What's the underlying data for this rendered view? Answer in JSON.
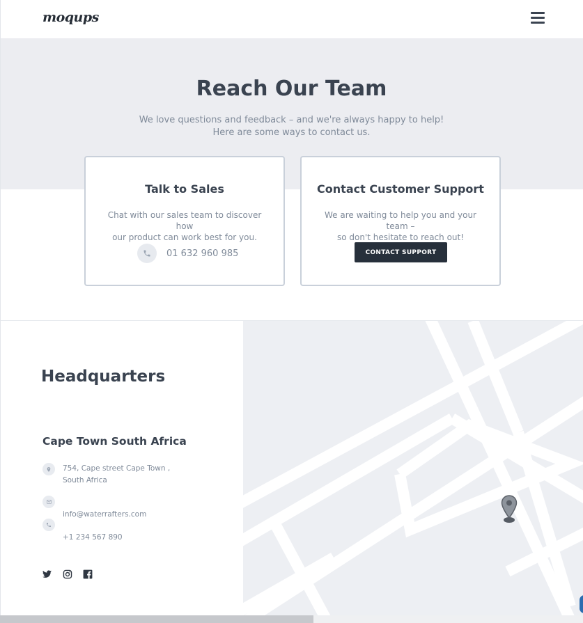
{
  "header": {
    "logo": "moqups",
    "menu_icon": "hamburger-menu-icon"
  },
  "hero": {
    "title": "Reach Our Team",
    "subtitle_line1": "We love questions and feedback – and we're always happy to help!",
    "subtitle_line2": "Here are some ways to contact us."
  },
  "sales_card": {
    "title": "Talk to Sales",
    "desc_line1": "Chat with our sales team to discover how",
    "desc_line2": "our product can work best for you.",
    "phone": "01 632 960 985",
    "phone_icon": "phone-icon"
  },
  "support_card": {
    "title": "Contact Customer Support",
    "desc_line1": "We are waiting to help you and your team –",
    "desc_line2": "so don't hesitate to reach out!",
    "button_label": "CONTACT SUPPORT"
  },
  "headquarters": {
    "heading": "Headquarters",
    "city": "Cape Town South Africa",
    "address_line1": "754, Cape street Cape Town ,",
    "address_line2": "South Africa",
    "email": "info@waterrafters.com",
    "phone": "+1 234 567 890",
    "icons": [
      "map-pin-icon",
      "mail-icon",
      "phone-icon"
    ]
  },
  "social": [
    "twitter-icon",
    "instagram-icon",
    "facebook-icon"
  ],
  "map": {
    "marker_icon": "map-marker-icon"
  },
  "colors": {
    "text_dark": "#3a4350",
    "text_muted": "#7f8a99",
    "hero_bg": "#ecedf1",
    "button_bg": "#27303b",
    "map_bg": "#edeff3"
  }
}
